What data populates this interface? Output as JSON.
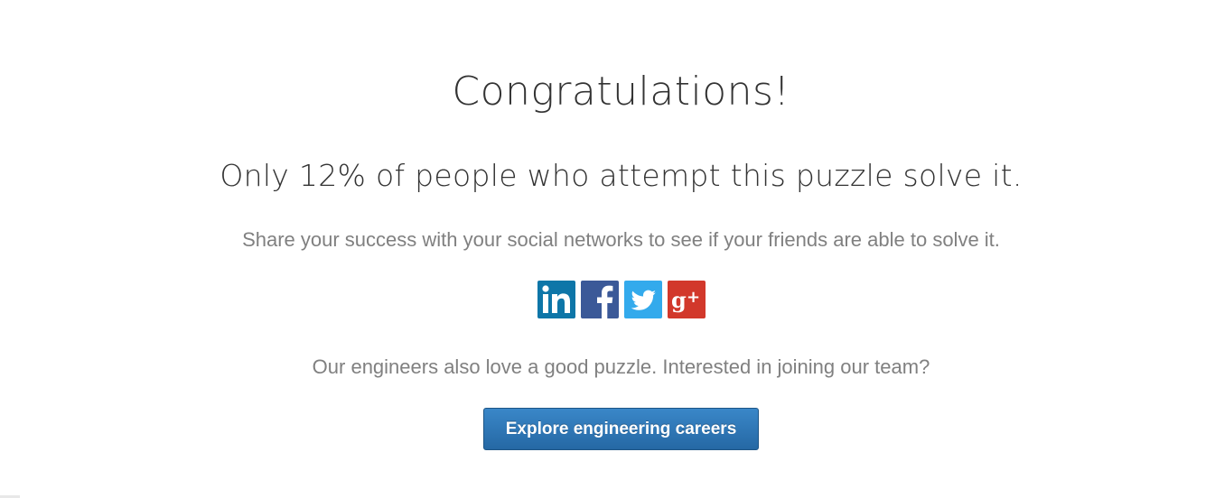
{
  "heading": "Congratulations!",
  "stat_line": "Only 12% of people who attempt this puzzle solve it.",
  "share_prompt": "Share your success with your social networks to see if your friends are able to solve it.",
  "social": [
    {
      "name": "linkedin",
      "icon": "linkedin-icon",
      "color": "#0e76a8",
      "glyph": "in"
    },
    {
      "name": "facebook",
      "icon": "facebook-icon",
      "color": "#3b5998",
      "glyph": "f"
    },
    {
      "name": "twitter",
      "icon": "twitter-icon",
      "color": "#33aaec",
      "glyph": "bird"
    },
    {
      "name": "google-plus",
      "icon": "google-plus-icon",
      "color": "#d2382b",
      "glyph": "g+"
    }
  ],
  "careers_prompt": "Our engineers also love a good puzzle. Interested in joining our team?",
  "cta_label": "Explore engineering careers",
  "colors": {
    "heading": "#333333",
    "body_text": "#808080",
    "button_top": "#3a87c8",
    "button_bottom": "#2568a4"
  }
}
